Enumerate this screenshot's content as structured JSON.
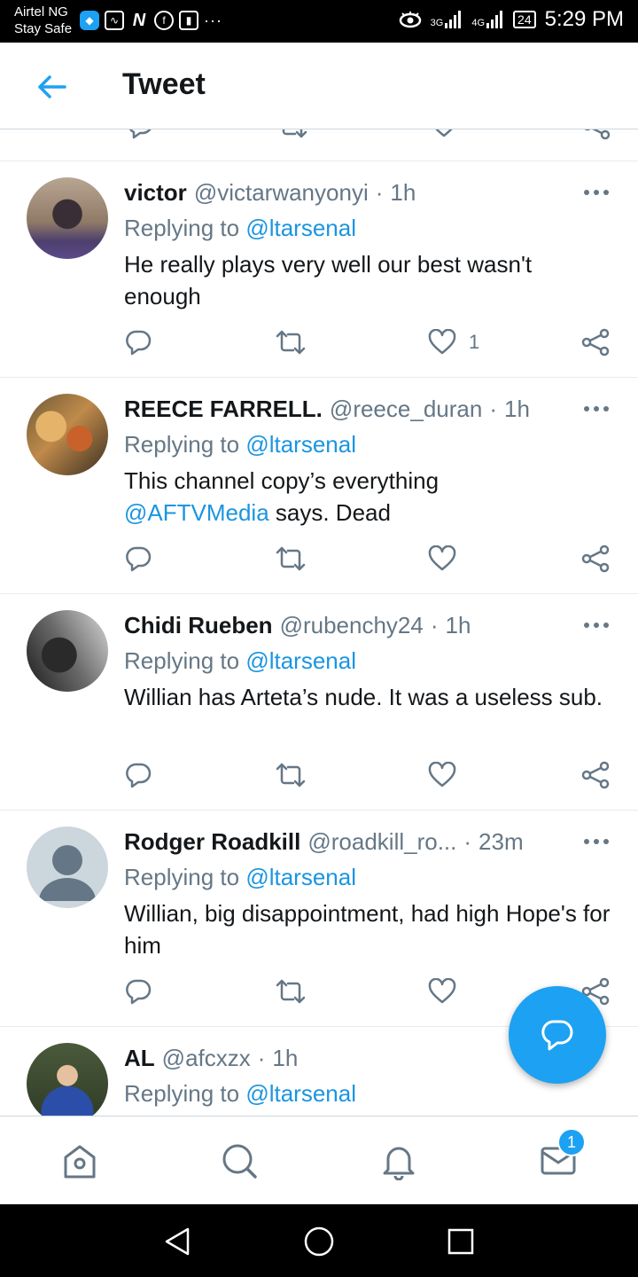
{
  "status_bar": {
    "carrier_line1": "Airtel NG",
    "carrier_line2": "Stay Safe",
    "network_label_1": "3G",
    "network_label_2": "4G",
    "battery": "24",
    "time": "5:29 PM"
  },
  "header": {
    "title": "Tweet"
  },
  "tweets": [
    {
      "name": "victor",
      "handle": "@victarwanyonyi",
      "time": "1h",
      "replying_prefix": "Replying to ",
      "replying_to": "@ltarsenal",
      "body_text": "He really plays very well our best wasn't enough",
      "like_count": "1"
    },
    {
      "name": "REECE FARRELL.",
      "handle": "@reece_duran",
      "time": "1h",
      "replying_prefix": "Replying to ",
      "replying_to": "@ltarsenal",
      "body_line1": "This channel copy’s everything",
      "body_mention": "@AFTVMedia",
      "body_suffix": " says. Dead"
    },
    {
      "name": "Chidi Rueben",
      "handle": "@rubenchy24",
      "time": "1h",
      "replying_prefix": "Replying to ",
      "replying_to": "@ltarsenal",
      "body_text": "Willian has Arteta’s nude. It was a useless sub."
    },
    {
      "name": "Rodger Roadkill",
      "handle": "@roadkill_ro...",
      "time": "23m",
      "replying_prefix": "Replying to ",
      "replying_to": "@ltarsenal",
      "body_text": "Willian, big disappointment, had high Hope's for him"
    },
    {
      "name": "AL",
      "handle": "@afcxzx",
      "time": "1h",
      "replying_prefix": "Replying to ",
      "replying_to": "@ltarsenal"
    }
  ],
  "bottom_nav": {
    "messages_badge": "1"
  },
  "colors": {
    "accent": "#1da1f2",
    "link": "#1b95e0",
    "secondary_text": "#657786",
    "divider": "#e6ecf0"
  },
  "icons": [
    "back-arrow-icon",
    "more-icon",
    "reply-icon",
    "retweet-icon",
    "like-icon",
    "share-icon",
    "compose-reply-icon",
    "home-icon",
    "search-icon",
    "notifications-icon",
    "messages-icon",
    "back-triangle-icon",
    "home-circle-icon",
    "recents-square-icon"
  ]
}
